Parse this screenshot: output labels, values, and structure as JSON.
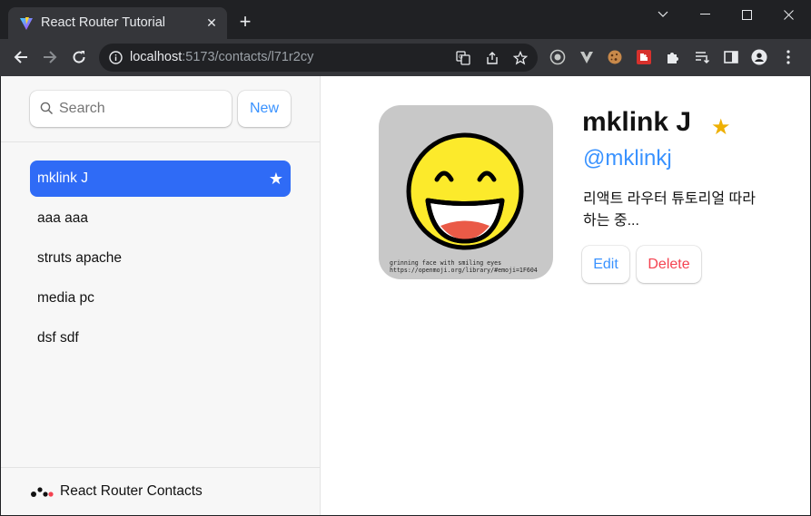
{
  "browser": {
    "tab": {
      "title": "React Router Tutorial",
      "favicon": "vite-icon"
    },
    "url": {
      "host": "localhost",
      "path": ":5173/contacts/l71r2cy"
    },
    "window_controls": [
      "minimize",
      "maximize",
      "close"
    ],
    "extensions": [
      "circle-target-icon",
      "v-icon",
      "cookie-icon",
      "red-puzzle-icon",
      "puzzle-icon",
      "reading-list-icon",
      "side-panel-icon",
      "profile-icon",
      "menu-icon"
    ]
  },
  "sidebar": {
    "search": {
      "placeholder": "Search"
    },
    "new_label": "New",
    "contacts": [
      {
        "name": "mklink J",
        "favorite": true,
        "active": true
      },
      {
        "name": "aaa aaa",
        "favorite": false,
        "active": false
      },
      {
        "name": "struts apache",
        "favorite": false,
        "active": false
      },
      {
        "name": "media pc",
        "favorite": false,
        "active": false
      },
      {
        "name": "dsf sdf",
        "favorite": false,
        "active": false
      }
    ],
    "footer": "React Router Contacts"
  },
  "contact": {
    "name": "mklink J",
    "favorite_star": "★",
    "handle": "@mklinkj",
    "notes": "리액트 라우터 튜토리얼 따라하는 중...",
    "avatar_caption_1": "grinning face with smiling eyes",
    "avatar_caption_2": "https://openmoji.org/library/#emoji=1F604",
    "edit_label": "Edit",
    "delete_label": "Delete"
  },
  "colors": {
    "accent": "#3992ff",
    "active_item": "#2f6bf6",
    "star": "#eeb004",
    "danger": "#f44250"
  }
}
